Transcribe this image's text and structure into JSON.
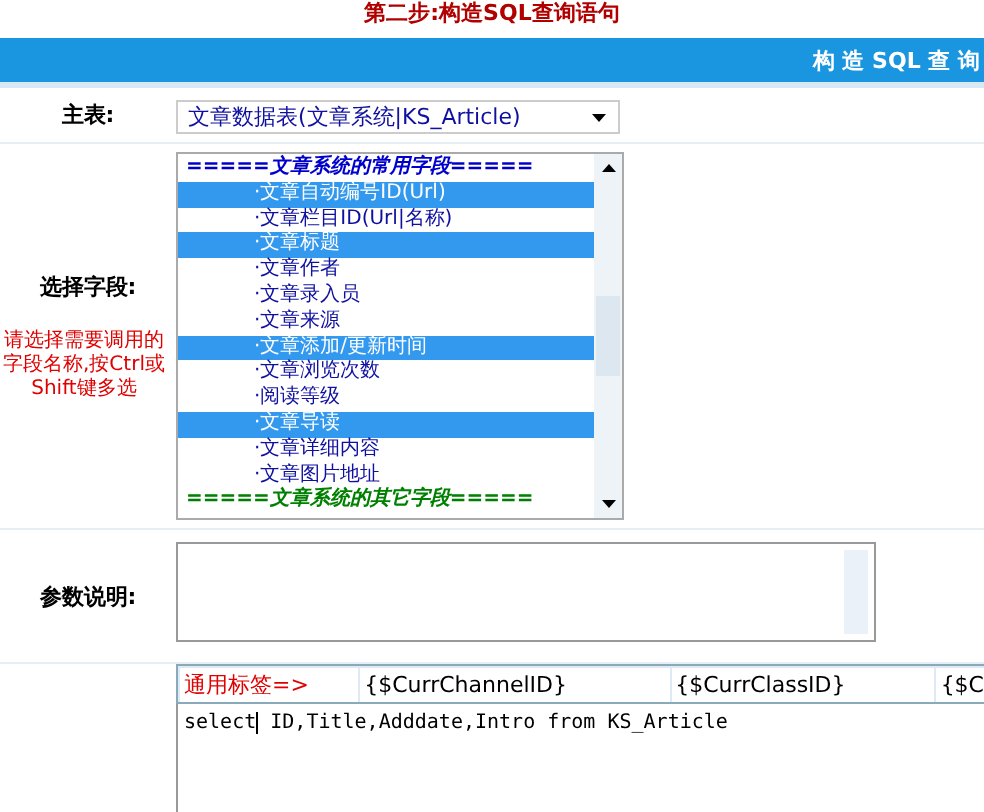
{
  "page_title": "第二步:构造SQL查询语句",
  "header_bar": {
    "title": "构 造 SQL 查 询"
  },
  "main_table": {
    "label": "主表:",
    "value": "文章数据表(文章系统|KS_Article)"
  },
  "fields": {
    "label": "选择字段:",
    "hint": "请选择需要调用的字段名称,按Ctrl或Shift键多选",
    "items": [
      {
        "kind": "header",
        "text": "=====文章系统的常用字段=====",
        "color": "#0000cc"
      },
      {
        "kind": "option",
        "text": "·文章自动编号ID(Url)",
        "selected": true
      },
      {
        "kind": "option",
        "text": "·文章栏目ID(Url|名称)",
        "selected": false
      },
      {
        "kind": "option",
        "text": "·文章标题",
        "selected": true
      },
      {
        "kind": "option",
        "text": "·文章作者",
        "selected": false
      },
      {
        "kind": "option",
        "text": "·文章录入员",
        "selected": false
      },
      {
        "kind": "option",
        "text": "·文章来源",
        "selected": false
      },
      {
        "kind": "option",
        "text": "·文章添加/更新时间",
        "selected": true
      },
      {
        "kind": "option",
        "text": "·文章浏览次数",
        "selected": false
      },
      {
        "kind": "option",
        "text": "·阅读等级",
        "selected": false
      },
      {
        "kind": "option",
        "text": "·文章导读",
        "selected": true
      },
      {
        "kind": "option",
        "text": "·文章详细内容",
        "selected": false
      },
      {
        "kind": "option",
        "text": "·文章图片地址",
        "selected": false
      },
      {
        "kind": "header",
        "text": "=====文章系统的其它字段=====",
        "color": "#008000"
      }
    ]
  },
  "param_desc": {
    "label": "参数说明:"
  },
  "tags": [
    {
      "kind": "label",
      "text": "通用标签=>"
    },
    {
      "kind": "tag",
      "text": "{$CurrChannelID}"
    },
    {
      "kind": "tag",
      "text": "{$CurrClassID}"
    },
    {
      "kind": "tag",
      "text": "{$C"
    }
  ],
  "sql": {
    "before_cursor": "select",
    "after_cursor": " ID,Title,Adddate,Intro from KS_Article"
  }
}
